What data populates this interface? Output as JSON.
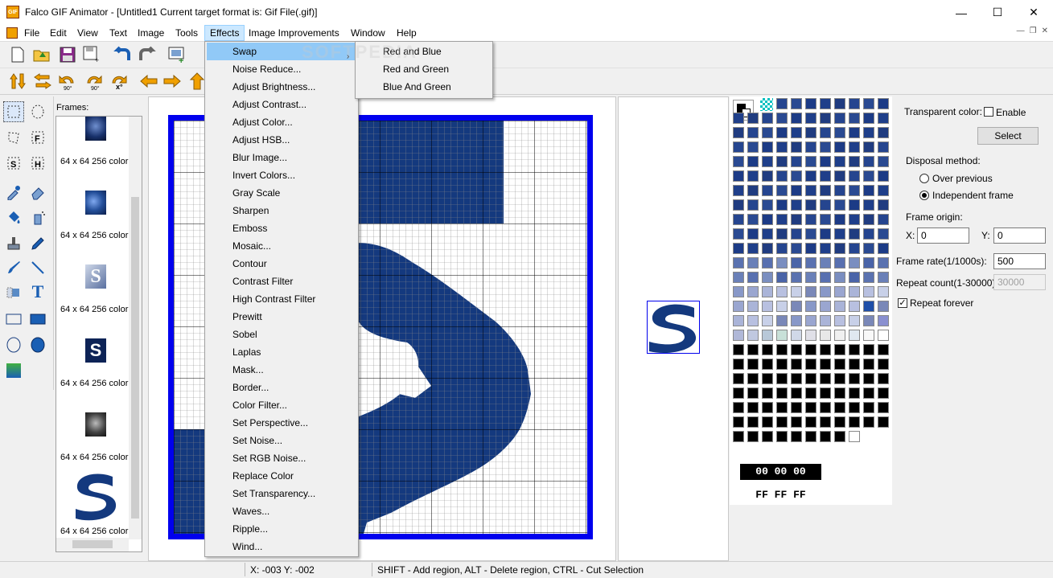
{
  "window": {
    "title": "Falco GIF Animator - [Untitled1  Current target format is: Gif File(.gif)]",
    "app_icon_text": "GIF",
    "controls": [
      "—",
      "☐",
      "✕"
    ]
  },
  "menubar": {
    "items": [
      "File",
      "Edit",
      "View",
      "Text",
      "Image",
      "Tools",
      "Effects",
      "Image Improvements",
      "Window",
      "Help"
    ],
    "active": "Effects",
    "mdi_controls": [
      "—",
      "❐",
      "✕"
    ]
  },
  "frames": {
    "label": "Frames:",
    "items": [
      {
        "label": "64 x 64 256 color",
        "thumb": "swirl-s"
      },
      {
        "label": "64 x 64 256 color",
        "thumb": "blue-blur"
      },
      {
        "label": "64 x 64 256 color",
        "thumb": "metal-s"
      },
      {
        "label": "64 x 64 256 color",
        "thumb": "navy-s"
      },
      {
        "label": "64 x 64 256 color",
        "thumb": "gray-s"
      },
      {
        "label": "64 x 64 256 color",
        "thumb": "big-s"
      }
    ]
  },
  "effects_menu": {
    "items": [
      "Swap",
      "Noise Reduce...",
      "Adjust Brightness...",
      "Adjust Contrast...",
      "Adjust Color...",
      "Adjust HSB...",
      "Blur Image...",
      "Invert Colors...",
      "Gray Scale",
      "Sharpen",
      "Emboss",
      "Mosaic...",
      "Contour",
      "Contrast Filter",
      "High Contrast Filter",
      "Prewitt",
      "Sobel",
      "Laplas",
      "Mask...",
      "Border...",
      "Color Filter...",
      "Set Perspective...",
      "Set Noise...",
      "Set RGB Noise...",
      "Replace Color",
      "Set Transparency...",
      "Waves...",
      "Ripple...",
      "Wind..."
    ],
    "highlighted": "Swap",
    "submenu_arrow": "›"
  },
  "swap_submenu": {
    "items": [
      "Red and Blue",
      "Red and Green",
      "Blue And Green"
    ]
  },
  "palette": {
    "foreground_hex": "00 00 00",
    "background_hex": "FF FF FF"
  },
  "properties": {
    "transparent_color_label": "Transparent color:",
    "enable_label": "Enable",
    "enable_checked": false,
    "select_button": "Select",
    "disposal_label": "Disposal method:",
    "disposal_options": [
      "Over previous",
      "Independent frame"
    ],
    "disposal_selected": "Independent frame",
    "frame_origin_label": "Frame origin:",
    "x_label": "X:",
    "x_value": "0",
    "y_label": "Y:",
    "y_value": "0",
    "frame_rate_label": "Frame rate(1/1000s):",
    "frame_rate_value": "500",
    "repeat_count_label": "Repeat count(1-30000):",
    "repeat_count_value": "30000",
    "repeat_forever_label": "Repeat forever",
    "repeat_forever_checked": true
  },
  "statusbar": {
    "coords": "X: -003 Y: -002",
    "hint": "SHIFT - Add region, ALT - Delete region, CTRL - Cut Selection"
  },
  "colors": {
    "canvas_border": "#0000ee",
    "artwork_navy": "#14397e",
    "menu_highlight": "#91c9f7"
  },
  "watermark": "SOFTPEDIA"
}
